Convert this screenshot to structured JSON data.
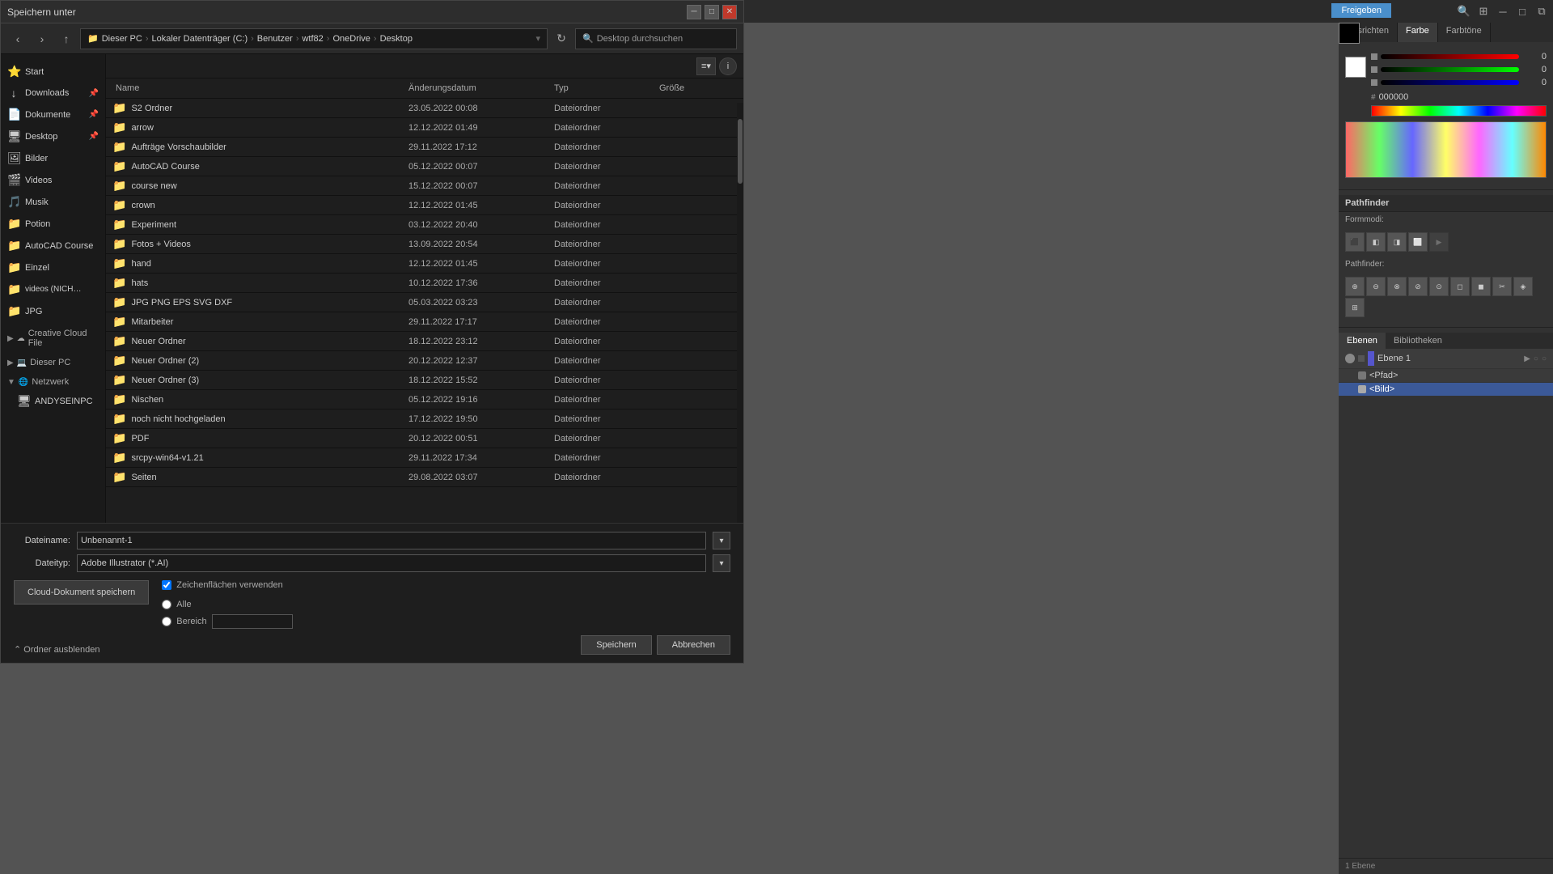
{
  "app": {
    "title": "Speichern unter",
    "freigeben_label": "Freigeben"
  },
  "titlebar": {
    "close_symbol": "✕",
    "min_symbol": "─",
    "max_symbol": "□"
  },
  "nav": {
    "back_symbol": "‹",
    "forward_symbol": "›",
    "up_symbol": "↑",
    "refresh_symbol": "↻",
    "breadcrumb": [
      "Dieser PC",
      "Lokaler Datenträger (C:)",
      "Benutzer",
      "wtf82",
      "OneDrive",
      "Desktop"
    ],
    "search_placeholder": "Desktop durchsuchen"
  },
  "sidebar": {
    "items": [
      {
        "id": "start",
        "label": "Start",
        "icon": "⭐",
        "pinned": false
      },
      {
        "id": "downloads",
        "label": "Downloads",
        "icon": "↓",
        "pinned": true
      },
      {
        "id": "dokumente",
        "label": "Dokumente",
        "icon": "📄",
        "pinned": true
      },
      {
        "id": "desktop",
        "label": "Desktop",
        "icon": "🖥",
        "pinned": true
      },
      {
        "id": "bilder",
        "label": "Bilder",
        "icon": "🖼",
        "pinned": false
      },
      {
        "id": "videos",
        "label": "Videos",
        "icon": "🎬",
        "pinned": false
      },
      {
        "id": "musik",
        "label": "Musik",
        "icon": "🎵",
        "pinned": false
      },
      {
        "id": "potion",
        "label": "Potion",
        "icon": "📁",
        "pinned": false
      },
      {
        "id": "autocad",
        "label": "AutoCAD Course",
        "icon": "📁",
        "pinned": false
      },
      {
        "id": "einzel",
        "label": "Einzel",
        "icon": "📁",
        "pinned": false
      },
      {
        "id": "videos2",
        "label": "videos (NICHT FER...",
        "icon": "📁",
        "pinned": false
      },
      {
        "id": "jpg",
        "label": "JPG",
        "icon": "📁",
        "pinned": false
      }
    ],
    "sections": [
      {
        "id": "creative-cloud",
        "label": "Creative Cloud File",
        "expanded": false
      },
      {
        "id": "dieser-pc",
        "label": "Dieser PC",
        "expanded": false
      },
      {
        "id": "netzwerk",
        "label": "Netzwerk",
        "expanded": true
      },
      {
        "id": "andyseinpc",
        "label": "ANDYSEINPC",
        "icon": "🖥"
      }
    ]
  },
  "file_table": {
    "headers": [
      "Name",
      "Änderungsdatum",
      "Typ",
      "Größe"
    ],
    "rows": [
      {
        "name": "S2 Ordner",
        "date": "23.05.2022 00:08",
        "type": "Dateiordner",
        "size": ""
      },
      {
        "name": "arrow",
        "date": "12.12.2022 01:49",
        "type": "Dateiordner",
        "size": ""
      },
      {
        "name": "Aufträge Vorschaubilder",
        "date": "29.11.2022 17:12",
        "type": "Dateiordner",
        "size": ""
      },
      {
        "name": "AutoCAD Course",
        "date": "05.12.2022 00:07",
        "type": "Dateiordner",
        "size": ""
      },
      {
        "name": "course new",
        "date": "15.12.2022 00:07",
        "type": "Dateiordner",
        "size": ""
      },
      {
        "name": "crown",
        "date": "12.12.2022 01:45",
        "type": "Dateiordner",
        "size": ""
      },
      {
        "name": "Experiment",
        "date": "03.12.2022 20:40",
        "type": "Dateiordner",
        "size": ""
      },
      {
        "name": "Fotos + Videos",
        "date": "13.09.2022 20:54",
        "type": "Dateiordner",
        "size": ""
      },
      {
        "name": "hand",
        "date": "12.12.2022 01:45",
        "type": "Dateiordner",
        "size": ""
      },
      {
        "name": "hats",
        "date": "10.12.2022 17:36",
        "type": "Dateiordner",
        "size": ""
      },
      {
        "name": "JPG PNG EPS SVG DXF",
        "date": "05.03.2022 03:23",
        "type": "Dateiordner",
        "size": ""
      },
      {
        "name": "Mitarbeiter",
        "date": "29.11.2022 17:17",
        "type": "Dateiordner",
        "size": ""
      },
      {
        "name": "Neuer Ordner",
        "date": "18.12.2022 23:12",
        "type": "Dateiordner",
        "size": ""
      },
      {
        "name": "Neuer Ordner (2)",
        "date": "20.12.2022 12:37",
        "type": "Dateiordner",
        "size": ""
      },
      {
        "name": "Neuer Ordner (3)",
        "date": "18.12.2022 15:52",
        "type": "Dateiordner",
        "size": ""
      },
      {
        "name": "Nischen",
        "date": "05.12.2022 19:16",
        "type": "Dateiordner",
        "size": ""
      },
      {
        "name": "noch nicht hochgeladen",
        "date": "17.12.2022 19:50",
        "type": "Dateiordner",
        "size": ""
      },
      {
        "name": "PDF",
        "date": "20.12.2022 00:51",
        "type": "Dateiordner",
        "size": ""
      },
      {
        "name": "srcpy-win64-v1.21",
        "date": "29.11.2022 17:34",
        "type": "Dateiordner",
        "size": ""
      },
      {
        "name": "Seiten",
        "date": "29.08.2022 03:07",
        "type": "Dateiordner",
        "size": ""
      }
    ]
  },
  "bottom": {
    "filename_label": "Dateiname:",
    "filetype_label": "Dateityp:",
    "filename_value": "Unbenannt-1",
    "filetype_value": "Adobe Illustrator (*.AI)",
    "cloud_btn_label": "Cloud-Dokument\nspeichern",
    "checkbox_label": "Zeichenflächen verwenden",
    "radio_alle": "Alle",
    "radio_bereich": "Bereich",
    "save_btn": "Speichern",
    "cancel_btn": "Abbrechen",
    "ordner_label": "⌃ Ordner ausblenden"
  },
  "right_panel": {
    "tabs": {
      "ausrichten": "Ausrichten",
      "farbe": "Farbe",
      "farbtöne": "Farbtöne"
    },
    "color": {
      "r": 0,
      "g": 0,
      "b": 0,
      "hex": "000000"
    },
    "pathfinder_title": "Pathfinder",
    "formmode_title": "Formmodi:",
    "pathfinder2_title": "Pathfinder:",
    "layers_tabs": [
      "Ebenen",
      "Bibliotheken"
    ],
    "layers": [
      {
        "name": "Ebene 1",
        "active": true
      },
      {
        "name": "<Pfad>",
        "indent": true
      },
      {
        "name": "<Bild>",
        "indent": true,
        "selected": true
      }
    ],
    "layer_count": "1 Ebene"
  }
}
